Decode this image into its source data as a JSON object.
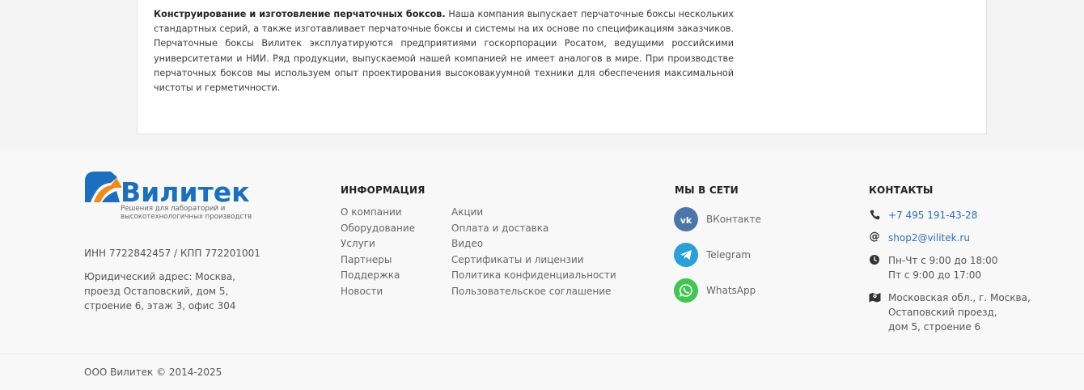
{
  "content": {
    "lead": "Конструирование и изготовление перчаточных боксов.",
    "text": " Наша компания выпускает перчаточные боксы нескольких стандартных серий, а также изготавливает перчаточные боксы и системы на их основе по спецификациям заказчиков. Перчаточные боксы Вилитек эксплуатируются предприятиями госкорпорации Росатом, ведущими российскими университетами и НИИ. Ряд продукции, выпускаемой нашей компанией не имеет аналогов в мире. При производстве перчаточных боксов мы используем опыт проектирования высоковакуумной техники для обеспечения максимальной чистоты и герметичности."
  },
  "footer": {
    "logo": {
      "name": "Вилитек",
      "tagline": "Решения для лабораторий и высокотехнологичных производств",
      "colors": {
        "brand_blue": "#1c6fbf",
        "brand_orange": "#f08a1c"
      }
    },
    "legal": {
      "ids": "ИНН 7722842457 / КПП 772201001",
      "address_line1": "Юридический адрес: Москва,",
      "address_line2": "проезд Остаповский, дом 5,",
      "address_line3": "строение 6, этаж 3, офис 304"
    },
    "info": {
      "title": "ИНФОРМАЦИЯ",
      "col1": [
        "О компании",
        "Оборудование",
        "Услуги",
        "Партнеры",
        "Поддержка",
        "Новости"
      ],
      "col2": [
        "Акции",
        "Оплата и доставка",
        "Видео",
        "Сертификаты и лицензии",
        "Политика конфиденциальности",
        "Пользовательское соглашение"
      ]
    },
    "social": {
      "title": "МЫ В СЕТИ",
      "items": [
        {
          "label": "ВКонтакте",
          "icon": "vk-icon",
          "color": "#4a76a8"
        },
        {
          "label": "Telegram",
          "icon": "telegram-icon",
          "color": "#2a9fd8"
        },
        {
          "label": "WhatsApp",
          "icon": "whatsapp-icon",
          "color": "#43c553"
        }
      ]
    },
    "contacts": {
      "title": "КОНТАКТЫ",
      "phone": "+7 495 191-43-28",
      "email": "shop2@vilitek.ru",
      "hours_line1": "Пн-Чт с 9:00 до 18:00",
      "hours_line2": "Пт с 9:00 до 17:00",
      "address_line1": "Московская обл., г. Москва,",
      "address_line2": "Остаповский проезд,",
      "address_line3": "дом 5, строение 6",
      "link_color": "#2f6fbd"
    },
    "copyright": "ООО Вилитек © 2014-2025"
  }
}
